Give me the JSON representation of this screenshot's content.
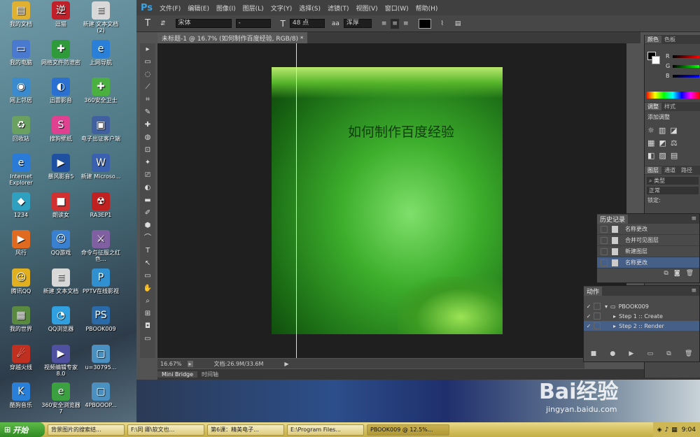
{
  "desktop_icons": [
    {
      "label": "我的文档",
      "glyph": "▤",
      "color": "#e0b030"
    },
    {
      "label": "逗猫",
      "glyph": "逆",
      "color": "#c0202a"
    },
    {
      "label": "新建 文本文档 (2)",
      "glyph": "≣",
      "color": "#d8d8d8"
    },
    {
      "label": "我的电脑",
      "glyph": "▭",
      "color": "#4a7ad0"
    },
    {
      "label": "网络文件防泄密",
      "glyph": "✚",
      "color": "#2f9a3a"
    },
    {
      "label": "上网导航",
      "glyph": "e",
      "color": "#2a80d8"
    },
    {
      "label": "网上邻居",
      "glyph": "◉",
      "color": "#3a8ad0"
    },
    {
      "label": "迅雷影音",
      "glyph": "◐",
      "color": "#2a70d0"
    },
    {
      "label": "360安全卫士",
      "glyph": "✚",
      "color": "#4ab040"
    },
    {
      "label": "回收站",
      "glyph": "♻",
      "color": "#6aa060"
    },
    {
      "label": "搜狗壁纸",
      "glyph": "S",
      "color": "#e04090"
    },
    {
      "label": "电子出证客户端",
      "glyph": "▣",
      "color": "#4060a0"
    },
    {
      "label": "Internet Explorer",
      "glyph": "e",
      "color": "#2a7ad8"
    },
    {
      "label": "暴风影音5",
      "glyph": "▶",
      "color": "#2050a0"
    },
    {
      "label": "新建 Microso...",
      "glyph": "W",
      "color": "#3a60b0"
    },
    {
      "label": "1234",
      "glyph": "◆",
      "color": "#30a0c0"
    },
    {
      "label": "朗读女",
      "glyph": "■",
      "color": "#d03030"
    },
    {
      "label": "RA3EP1",
      "glyph": "☢",
      "color": "#c02020"
    },
    {
      "label": "风行",
      "glyph": "▶",
      "color": "#e06a20"
    },
    {
      "label": "QQ游戏",
      "glyph": "☺",
      "color": "#3a80d0"
    },
    {
      "label": "命令与征服之红色...",
      "glyph": "⚔",
      "color": "#8060a0"
    },
    {
      "label": "腾讯QQ",
      "glyph": "☺",
      "color": "#e0b020"
    },
    {
      "label": "新建 文本文档",
      "glyph": "≣",
      "color": "#d8d8d8"
    },
    {
      "label": "PPTV在线影视",
      "glyph": "P",
      "color": "#3090d0"
    },
    {
      "label": "我的世界",
      "glyph": "▦",
      "color": "#5a8a40"
    },
    {
      "label": "QQ浏览器",
      "glyph": "◔",
      "color": "#30a0e0"
    },
    {
      "label": "PBOOK009",
      "glyph": "PS",
      "color": "#2a6aa8"
    },
    {
      "label": "穿越火线",
      "glyph": "☄",
      "color": "#c03020"
    },
    {
      "label": "视频编辑专家 8.0",
      "glyph": "▶",
      "color": "#5050a0"
    },
    {
      "label": "u=30795...",
      "glyph": "▢",
      "color": "#4a90c0"
    },
    {
      "label": "酷狗音乐",
      "glyph": "K",
      "color": "#2a80d8"
    },
    {
      "label": "360安全浏览器7",
      "glyph": "e",
      "color": "#3aa040"
    },
    {
      "label": "4PBOOOP...",
      "glyph": "▢",
      "color": "#4a90c0"
    }
  ],
  "photoshop": {
    "logo": "Ps",
    "menus": [
      "文件(F)",
      "编辑(E)",
      "图像(I)",
      "图层(L)",
      "文字(Y)",
      "选择(S)",
      "滤镜(T)",
      "视图(V)",
      "窗口(W)",
      "帮助(H)"
    ],
    "options": {
      "tool_glyph": "T",
      "font_family": "宋体",
      "font_style": "-",
      "font_size": "48 点",
      "anti_alias_label": "aa",
      "anti_alias": "浑厚"
    },
    "document_tab": "未标题-1 @ 16.7% (如何制作百度经验, RGB/8) *",
    "canvas_text": "如何制作百度经验",
    "tools": [
      "▸",
      "▭",
      "◌",
      "⟋",
      "⌗",
      "✎",
      "✚",
      "◍",
      "⊡",
      "✦",
      "⎚",
      "◐",
      "▬",
      "✐",
      "⬢",
      "⌒",
      "T",
      "↖",
      "▭",
      "✋",
      "⌕",
      "⊞",
      "◘",
      "▭"
    ],
    "status": {
      "zoom": "16.67%",
      "doc": "文档:26.9M/33.6M"
    },
    "bottom_tabs": [
      "Mini Bridge",
      "时间轴"
    ],
    "panels": {
      "color_tabs": [
        "颜色",
        "色板"
      ],
      "color_channels": [
        "R",
        "G",
        "B"
      ],
      "adjust_tabs": [
        "调整",
        "样式"
      ],
      "adjust_title": "添加调整",
      "layers_tabs": [
        "图层",
        "通道",
        "路径"
      ],
      "layers_kind": "类型",
      "layers_mode": "正常",
      "layers_lock": "锁定:"
    },
    "history": {
      "title": "历史记录",
      "items": [
        {
          "label": "名称更改",
          "selected": false
        },
        {
          "label": "合并可见图层",
          "selected": false
        },
        {
          "label": "新建图层",
          "selected": false
        },
        {
          "label": "名称更改",
          "selected": true
        }
      ]
    },
    "actions": {
      "title": "动作",
      "items": [
        {
          "label": "PBOOK009",
          "level": 0,
          "selected": false
        },
        {
          "label": "Step 1 :: Create",
          "level": 1,
          "selected": false
        },
        {
          "label": "Step 2 :: Render",
          "level": 1,
          "selected": true
        }
      ]
    }
  },
  "watermark": {
    "logo": "Bai经验",
    "url": "jingyan.baidu.com"
  },
  "taskbar": {
    "start": "开始",
    "tasks": [
      {
        "label": "背景图片的搜索结...",
        "active": false
      },
      {
        "label": "F:\\同 卿\\软文也...",
        "active": false
      },
      {
        "label": "第6课：精美电子...",
        "active": false
      },
      {
        "label": "E:\\Program Files...",
        "active": false
      },
      {
        "label": "PBOOK009 @ 12.5%...",
        "active": true
      }
    ],
    "clock": "9:04"
  },
  "colors": {
    "ps_blue": "#3ea3e0",
    "selection": "#465f86",
    "canvas_green": "#3dae2c",
    "taskbar": "#d6c262"
  }
}
